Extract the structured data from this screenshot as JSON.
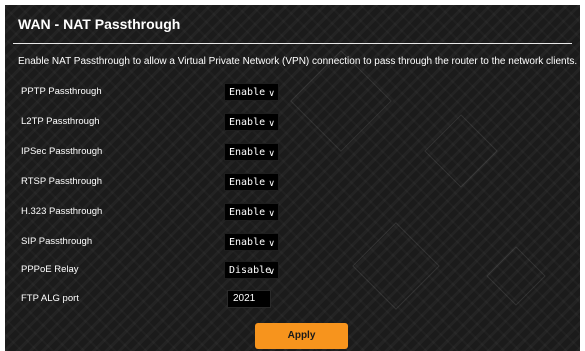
{
  "panel": {
    "title": "WAN - NAT Passthrough",
    "description": "Enable NAT Passthrough to allow a Virtual Private Network (VPN) connection to pass through the router to the network clients."
  },
  "settings": [
    {
      "label": "PPTP Passthrough",
      "value": "Enable"
    },
    {
      "label": "L2TP Passthrough",
      "value": "Enable"
    },
    {
      "label": "IPSec Passthrough",
      "value": "Enable"
    },
    {
      "label": "RTSP Passthrough",
      "value": "Enable"
    },
    {
      "label": "H.323 Passthrough",
      "value": "Enable"
    },
    {
      "label": "SIP Passthrough",
      "value": "Enable"
    },
    {
      "label": "PPPoE Relay",
      "value": "Disable"
    }
  ],
  "ftp_alg": {
    "label": "FTP ALG port",
    "value": "2021"
  },
  "apply_label": "Apply",
  "icons": {
    "dropdown": "chevron-down-icon"
  },
  "colors": {
    "accent": "#f7941d",
    "background": "#1b1b1b",
    "text": "#ffffff"
  }
}
